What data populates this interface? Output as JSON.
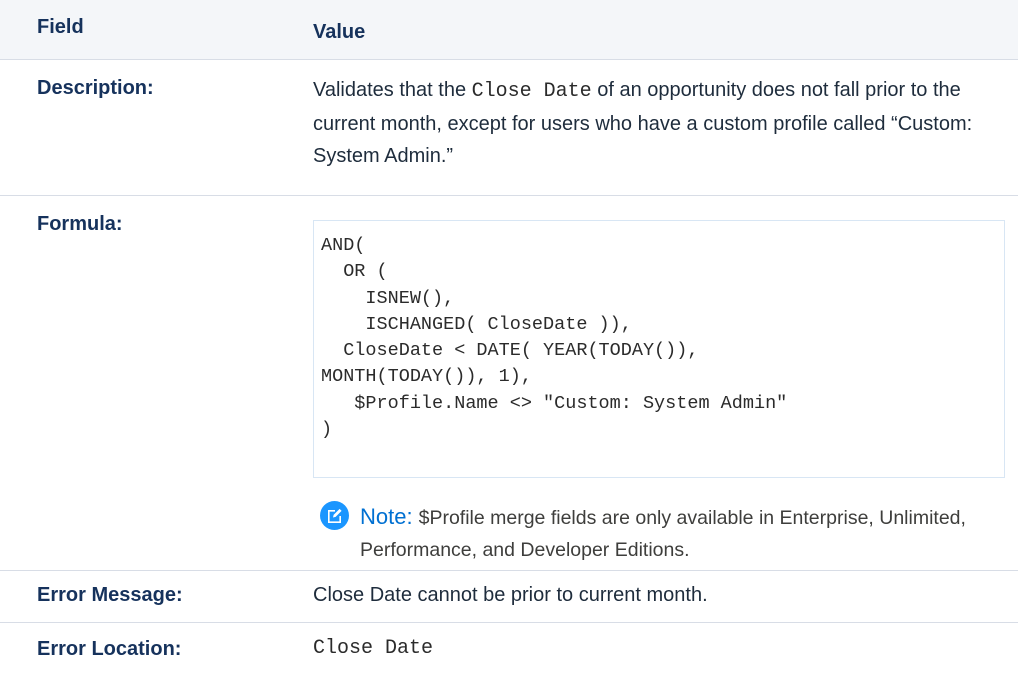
{
  "header": {
    "field": "Field",
    "value": "Value"
  },
  "description": {
    "label": "Description:",
    "text_before": "Validates that the ",
    "code": "Close Date",
    "text_after": " of an opportunity does not fall prior to the current month, except for users who have a custom profile called “Custom: System Admin.”"
  },
  "formula": {
    "label": "Formula:",
    "code": "AND(\n  OR (\n    ISNEW(),\n    ISCHANGED( CloseDate )),\n  CloseDate < DATE( YEAR(TODAY()),\nMONTH(TODAY()), 1),\n   $Profile.Name <> \"Custom: System Admin\"\n)",
    "note_label": "Note:",
    "note_text": "$Profile merge fields are only available in Enterprise, Unlimited, Performance, and Developer Editions.",
    "note_icon": "edit-note-icon"
  },
  "error_message": {
    "label": "Error Message:",
    "value": "Close Date cannot be prior to current month."
  },
  "error_location": {
    "label": "Error Location:",
    "value": "Close Date"
  },
  "colors": {
    "header_bg": "#f4f6f9",
    "note_icon": "#1b96ff",
    "note_label": "#0070d2",
    "divider": "#d8dde6"
  }
}
